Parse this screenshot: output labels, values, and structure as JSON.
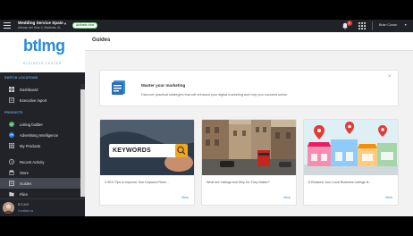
{
  "topbar": {
    "business_name": "Wedding Service Spain",
    "business_address": "Alfonso del Soto 3, Marbella, AL",
    "status_badge": "Activate view",
    "notification_count": "2",
    "user_name": "Brian Curran"
  },
  "sidebar": {
    "logo_text": "btlmg",
    "logo_subtitle": "BUSINESS CENTER",
    "section_locations": "SWITCH LOCATIONS",
    "section_products": "PRODUCTS",
    "items": [
      {
        "label": "Dashboard",
        "icon": "dashboard-icon"
      },
      {
        "label": "Executive report",
        "icon": "report-icon"
      },
      {
        "label": "Listing builder",
        "icon": "listing-icon"
      },
      {
        "label": "Advertising Intelligence",
        "icon": "advertising-icon"
      },
      {
        "label": "My Products",
        "icon": "products-icon"
      },
      {
        "label": "Recent Activity",
        "icon": "activity-icon"
      },
      {
        "label": "Store",
        "icon": "store-icon"
      },
      {
        "label": "Guides",
        "icon": "guides-icon"
      },
      {
        "label": "Files",
        "icon": "files-icon"
      }
    ],
    "active_item": "Guides",
    "footer_name": "BTLMG",
    "footer_link": "Contact us"
  },
  "main": {
    "page_title": "Guides",
    "banner": {
      "title": "Master your marketing",
      "text": "Discover practical strategies that will enhance your digital marketing and help you succeed online."
    },
    "cards": [
      {
        "title": "3 SEO Tips to Improve Your Keyword Rese...",
        "action": "View",
        "image": "keywords-search-photo",
        "image_text": "KEYWORDS"
      },
      {
        "title": "What are Listings and Why Do They Matter?",
        "action": "View",
        "image": "city-street-photo"
      },
      {
        "title": "6 Reasons Your Local Business Listings N...",
        "action": "View",
        "image": "storefront-map-illustration"
      }
    ]
  },
  "colors": {
    "accent": "#2a8bd6",
    "sidebar_bg": "#212329",
    "active_item_bg": "#454850",
    "status_green": "#2e7d32",
    "badge_red": "#e53935"
  }
}
